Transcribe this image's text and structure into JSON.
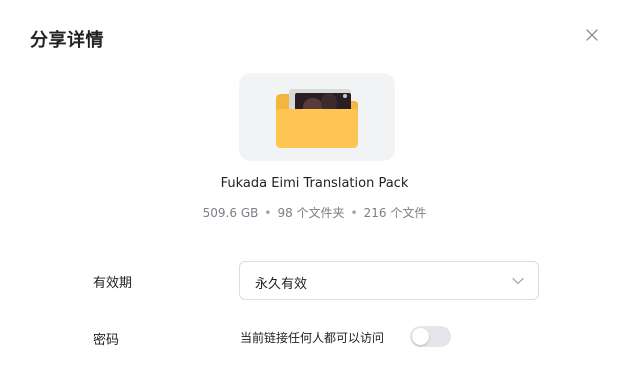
{
  "dialog": {
    "title": "分享详情",
    "close_icon": "close-icon"
  },
  "file": {
    "icon": "folder-icon",
    "name": "Fukada Eimi Translation Pack",
    "size": "509.6 GB",
    "folders": "98 个文件夹",
    "files": "216 个文件",
    "separator": "•"
  },
  "validity": {
    "label": "有效期",
    "selected": "永久有效",
    "dropdown_icon": "chevron-down-icon"
  },
  "password": {
    "label": "密码",
    "toggle_text": "当前链接任何人都可以访问",
    "toggle_on": false
  },
  "colors": {
    "folder": "#ffc553",
    "folder_back": "#f4b53f",
    "thumb_bg": "#f2f3f5",
    "toggle_off": "#e4e6eb"
  }
}
